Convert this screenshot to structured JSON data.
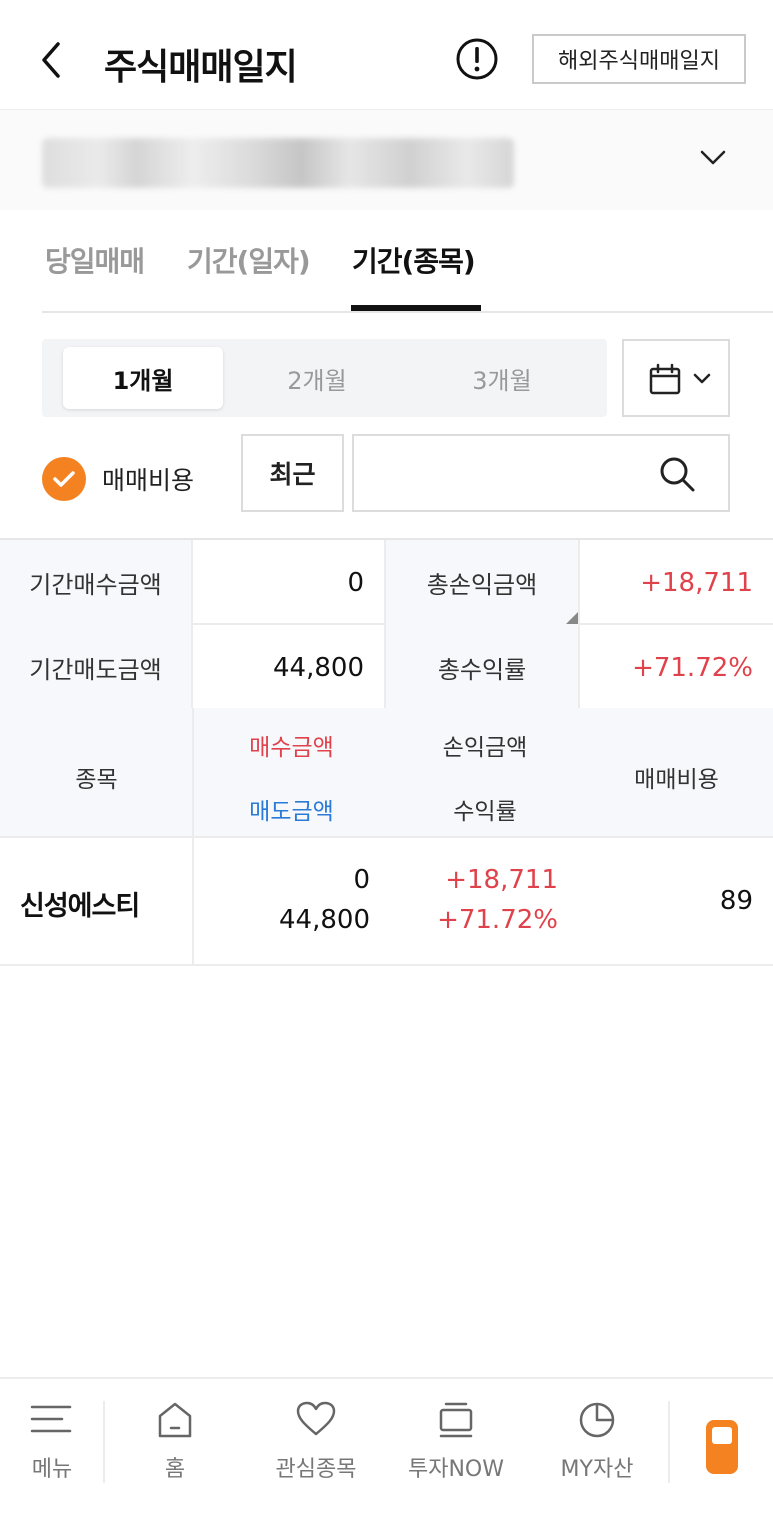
{
  "header": {
    "title": "주식매매일지",
    "overseas_button": "해외주식매매일지"
  },
  "tabs": [
    "당일매매",
    "기간(일자)",
    "기간(종목)"
  ],
  "period": {
    "options": [
      "1개월",
      "2개월",
      "3개월"
    ],
    "selected": "1개월"
  },
  "filters": {
    "fee_label": "매매비용",
    "recent_button": "최근",
    "search_value": ""
  },
  "summary": {
    "buy_amount_label": "기간매수금액",
    "buy_amount": "0",
    "total_pl_label": "총손익금액",
    "total_pl": "+18,711",
    "sell_amount_label": "기간매도금액",
    "sell_amount": "44,800",
    "total_rate_label": "총수익률",
    "total_rate": "+71.72%"
  },
  "columns": {
    "stock": "종목",
    "buy": "매수금액",
    "sell": "매도금액",
    "pl": "손익금액",
    "rate": "수익률",
    "fee": "매매비용"
  },
  "rows": [
    {
      "name": "신성에스티",
      "buy": "0",
      "sell": "44,800",
      "pl": "+18,711",
      "rate": "+71.72%",
      "fee": "89"
    }
  ],
  "bottom_nav": [
    "메뉴",
    "홈",
    "관심종목",
    "투자NOW",
    "MY자산"
  ],
  "colors": {
    "accent": "#f58220",
    "positive": "#e0424b",
    "sell": "#2a7ad8"
  }
}
